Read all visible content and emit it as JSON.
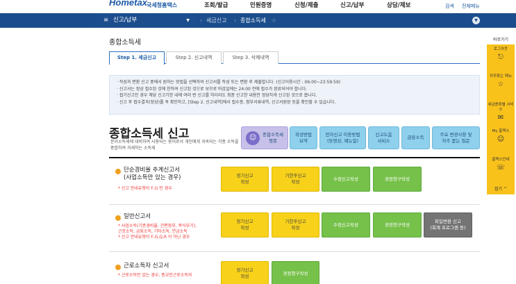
{
  "header": {
    "logo": "Hometax",
    "logo_sub": "국세청홈택스",
    "menu": [
      "조회/발급",
      "민원증명",
      "신청/제출",
      "신고/납부",
      "상담/제보"
    ],
    "utility": [
      "검색",
      "전체메뉴"
    ]
  },
  "subbar": {
    "menu_label": "신고/납부",
    "breadcrumb": [
      "세금신고",
      "종합소득세"
    ],
    "star": "☆"
  },
  "page_title": "종합소득세",
  "tabs": [
    {
      "label": "Step 1. 세금신고"
    },
    {
      "label": "Step 2. 신고내역"
    },
    {
      "label": "Step 3. 삭제내역"
    }
  ],
  "notice": [
    "· 작성과 변환 신고 중에서 원하는 방법을 선택하여 신고서를 작성 또는 변환 후 제출합니다. (신고이용시간 : 06:00~23:59:59)",
    "· 신고서는 정상 접수된 것에 한하여 신고된 것으로 보므로 마감일에는 24:00 전에 접수가 완료되어야 합니다.",
    "· 접기신고인 경우 해당 신고기한 내에 여러 번 신고를 하더라도 최종 신고한 내용만 정당하게 신고된 것으로 봅니다.",
    "· 신고 후 접수결과(정상)를 꼭 확인하고, [Step 2. 신고내역]에서 접수증, 첨부서류내역, 신고서원장 등을 확인할 수 있습니다."
  ],
  "main_title": "종합소득세 신고",
  "main_desc": "분리소득세에 대비하여 사용되는 용어로서 개인에게 귀속되는 각종 소득을 종합하여 과세하는 소득세",
  "help_buttons": [
    {
      "line1": "종합소득세",
      "line2": "챗봇"
    },
    {
      "line1": "작성방법",
      "line2": "요약"
    },
    {
      "line1": "전자신고 이용방법",
      "line2": "(동영상, 매뉴얼)"
    },
    {
      "line1": "신고도움",
      "line2": "서비스"
    },
    {
      "line1": "금융소득",
      "line2": ""
    },
    {
      "line1": "주요 변경사항 및",
      "line2": "자주 묻는 질문"
    }
  ],
  "sections": [
    {
      "title1": "단순경비율 추계신고서",
      "title2": "(사업소득만 있는 경우)",
      "notes": [
        "* 신고 안내유형이 F,G 인 경우"
      ],
      "buttons": [
        {
          "line1": "정기신고",
          "line2": "작성"
        },
        {
          "line1": "기한후신고",
          "line2": "작성"
        },
        {
          "line1": "수정신고작성",
          "line2": ""
        },
        {
          "line1": "경정청구작성",
          "line2": ""
        }
      ]
    },
    {
      "title1": "일반신고서",
      "title2": "",
      "notes": [
        "* 사업소득(기준경비율, 간편장부, 복식부기),",
        "  근로소득, 금융소득, 기타소득, 연금소득",
        "* 신고 안내유형이 F,G,Q,R 이 아닌 경우"
      ],
      "buttons": [
        {
          "line1": "정기신고",
          "line2": "작성"
        },
        {
          "line1": "기한후신고",
          "line2": "작성"
        },
        {
          "line1": "수정신고작성",
          "line2": ""
        },
        {
          "line1": "경정청구작성",
          "line2": ""
        },
        {
          "line1": "파일변환 신고",
          "line2": "(회계 프로그램 등)"
        }
      ]
    },
    {
      "title1": "근로소득자 신고서",
      "title2": "",
      "notes": [
        "* 근로소득만 있는 경우, 종교인근로소득자"
      ],
      "buttons": [
        {
          "line1": "정기신고",
          "line2": "작성"
        },
        {
          "line1": "경정청구작성",
          "line2": ""
        }
      ]
    }
  ],
  "rail": {
    "head": "바로가기",
    "items": [
      {
        "label": "로그아웃",
        "icon": "⎋"
      },
      {
        "label": "자주찾는 메뉴",
        "icon": "☆"
      },
      {
        "label": "세금종류별 서비스",
        "icon": "✉"
      },
      {
        "label": "My 홈택스",
        "icon": "☺"
      },
      {
        "label": "홈택스안내",
        "icon": "☏"
      }
    ],
    "close": "접기"
  },
  "colors": {
    "nav_blue": "#1b4d8c",
    "accent_yellow": "#f7d11a",
    "accent_green": "#76c14a",
    "accent_gray": "#747474",
    "rail_yellow": "#f9c21b"
  }
}
